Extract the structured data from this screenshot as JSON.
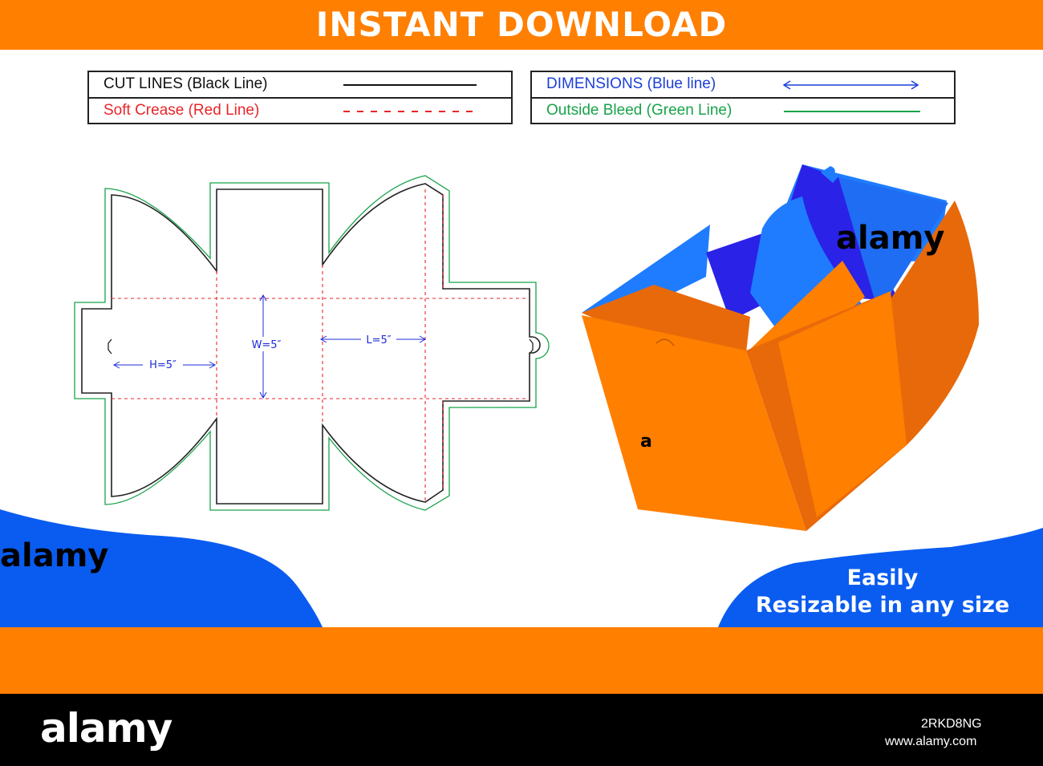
{
  "header": {
    "title": "INSTANT DOWNLOAD"
  },
  "legend_left": [
    {
      "label": "CUT LINES (Black Line)",
      "color": "#111111",
      "line_style": "solid"
    },
    {
      "label": "Soft Crease (Red Line)",
      "color": "#e8262a",
      "line_style": "dashed"
    }
  ],
  "legend_right": [
    {
      "label": "DIMENSIONS (Blue line)",
      "color": "#1c3fd8",
      "line_style": "double-arrow"
    },
    {
      "label": "Outside Bleed (Green Line)",
      "color": "#18a34a",
      "line_style": "solid"
    }
  ],
  "dieline": {
    "dimensions": [
      {
        "label": "H=5″"
      },
      {
        "label": "W=5″"
      },
      {
        "label": "L=5″"
      }
    ]
  },
  "promo": {
    "line1": "Easily",
    "line2": "Resizable in any size"
  },
  "watermark": {
    "word": "alamy",
    "letter": "a"
  },
  "footer": {
    "logo": "alamy",
    "image_id": "2RKD8NG",
    "url": "www.alamy.com"
  },
  "colors": {
    "brand_orange": "#ff7f00",
    "brand_blue": "#0a5cf0",
    "box_inner_blue": "#1f7cff",
    "box_deep_blue": "#2a22e6",
    "box_orange_dark": "#e8690a"
  }
}
